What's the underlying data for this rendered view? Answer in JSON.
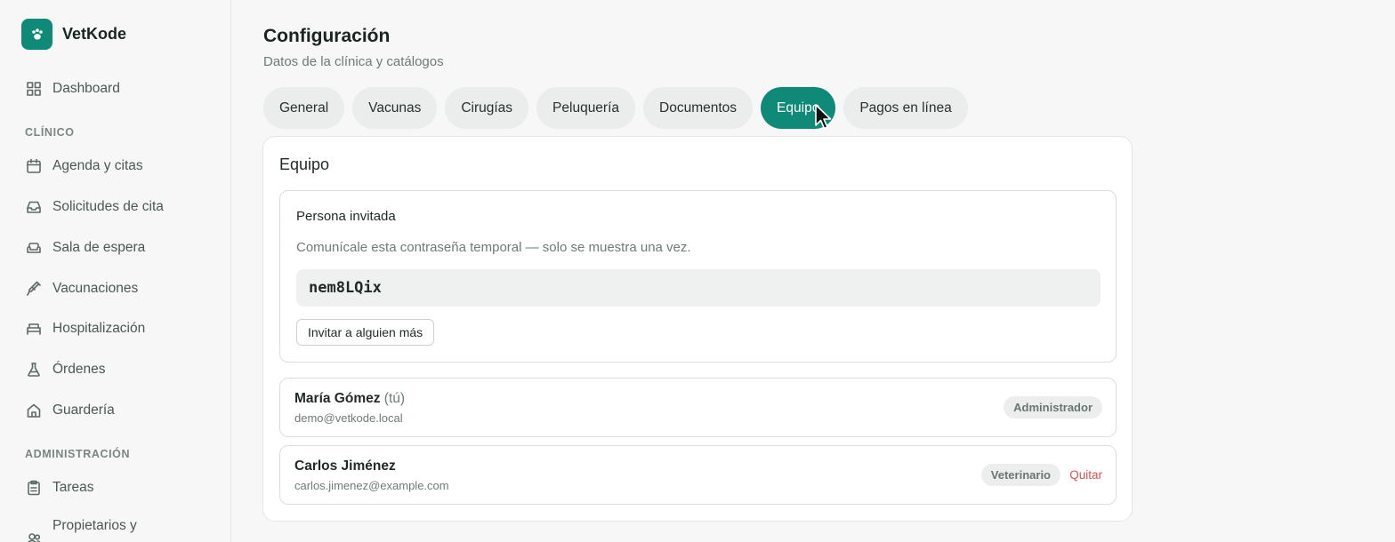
{
  "app": {
    "name": "VetKode",
    "brand_color": "#0f8a78"
  },
  "sidebar": {
    "items_top": [
      {
        "label": "Dashboard",
        "icon": "grid-icon"
      }
    ],
    "section_clinico": "CLÍNICO",
    "items_clinico": [
      {
        "label": "Agenda y citas",
        "icon": "calendar-icon"
      },
      {
        "label": "Solicitudes de cita",
        "icon": "inbox-icon"
      },
      {
        "label": "Sala de espera",
        "icon": "sofa-icon"
      },
      {
        "label": "Vacunaciones",
        "icon": "syringe-icon"
      },
      {
        "label": "Hospitalización",
        "icon": "bed-icon"
      },
      {
        "label": "Órdenes",
        "icon": "flask-icon"
      },
      {
        "label": "Guardería",
        "icon": "home-icon"
      }
    ],
    "section_admin": "ADMINISTRACIÓN",
    "items_admin": [
      {
        "label": "Tareas",
        "icon": "clipboard-icon"
      },
      {
        "label": "Propietarios y",
        "icon": "users-icon"
      }
    ]
  },
  "page": {
    "title": "Configuración",
    "subtitle": "Datos de la clínica y catálogos"
  },
  "tabs": [
    {
      "label": "General",
      "active": false
    },
    {
      "label": "Vacunas",
      "active": false
    },
    {
      "label": "Cirugías",
      "active": false
    },
    {
      "label": "Peluquería",
      "active": false
    },
    {
      "label": "Documentos",
      "active": false
    },
    {
      "label": "Equipo",
      "active": true
    },
    {
      "label": "Pagos en línea",
      "active": false
    }
  ],
  "team": {
    "title": "Equipo",
    "invite": {
      "title": "Persona invitada",
      "note": "Comunícale esta contraseña temporal — solo se muestra una vez.",
      "password": "nem8LQix",
      "button": "Invitar a alguien más"
    },
    "members": [
      {
        "name": "María Gómez",
        "you": "(tú)",
        "email": "demo@vetkode.local",
        "role": "Administrador",
        "action": ""
      },
      {
        "name": "Carlos Jiménez",
        "you": "",
        "email": "carlos.jimenez@example.com",
        "role": "Veterinario",
        "action": "Quitar"
      }
    ]
  }
}
